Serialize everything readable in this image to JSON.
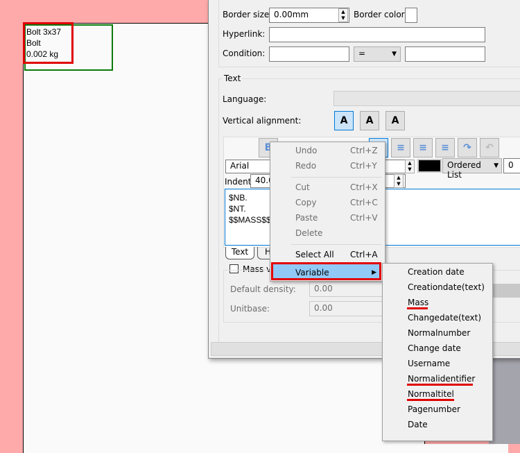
{
  "canvas": {
    "label_lines": [
      "Bolt 3x37",
      "Bolt",
      "0.002 kg"
    ]
  },
  "dialog": {
    "border_size_label": "Border size:",
    "border_size_value": "0.00mm",
    "border_color_label": "Border color:",
    "hyperlink_label": "Hyperlink:",
    "hyperlink_value": "",
    "condition_label": "Condition:",
    "condition_left": "",
    "condition_operator": "=",
    "condition_right": "",
    "text_group_label": "Text",
    "language_label": "Language:",
    "language_value": "",
    "vertical_alignment_label": "Vertical alignment:",
    "vertical_alignment_options": [
      "top",
      "middle",
      "bottom"
    ],
    "vertical_alignment_selected": "top",
    "font_value": "Arial",
    "text_color": "#000000",
    "list_type": "Ordered List",
    "list_value": "0",
    "indent_label": "Indent:",
    "indent_value": "40.00",
    "editor_lines": [
      "$NB.",
      "$NT.",
      "$$MASS$$"
    ],
    "tabs": [
      "Text",
      "H"
    ],
    "mass_checkbox_label": "Mass va",
    "mass_checked": false,
    "default_density_label": "Default density:",
    "default_density_value": "0.00",
    "unitbase_label": "Unitbase:",
    "unitbase_value": "0.00"
  },
  "context_menu": {
    "items": [
      {
        "label": "Undo",
        "shortcut": "Ctrl+Z",
        "enabled": false
      },
      {
        "label": "Redo",
        "shortcut": "Ctrl+Y",
        "enabled": false
      },
      {
        "label": "Cut",
        "shortcut": "Ctrl+X",
        "enabled": false
      },
      {
        "label": "Copy",
        "shortcut": "Ctrl+C",
        "enabled": false
      },
      {
        "label": "Paste",
        "shortcut": "Ctrl+V",
        "enabled": false
      },
      {
        "label": "Delete",
        "shortcut": "",
        "enabled": false
      },
      {
        "label": "Select All",
        "shortcut": "Ctrl+A",
        "enabled": true
      },
      {
        "label": "Variable",
        "shortcut": "",
        "enabled": true,
        "highlighted": true
      }
    ]
  },
  "submenu": {
    "items": [
      "Creation date",
      "Creationdate(text)",
      "Mass",
      "Changedate(text)",
      "Normalnumber",
      "Change date",
      "Username",
      "Normalidentifier",
      "Normaltitel",
      "Pagenumber",
      "Date"
    ],
    "underlined": [
      "Mass",
      "Normalidentifier",
      "Normaltitel"
    ]
  },
  "colors": {
    "highlight": "#e00000",
    "menu_hover": "#91c9f7",
    "canvas_margin": "#ffaaaa"
  }
}
